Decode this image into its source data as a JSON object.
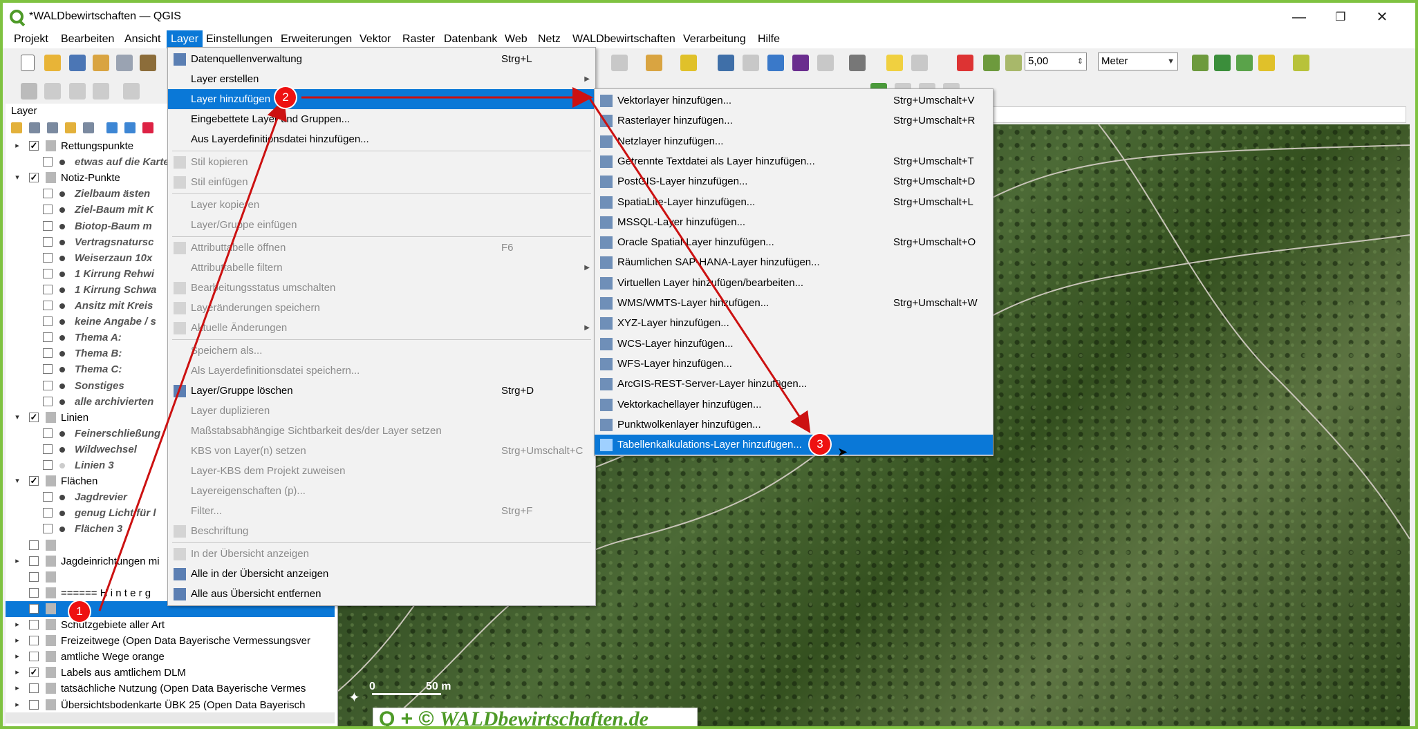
{
  "window": {
    "title": "*WALDbewirtschaften — QGIS",
    "minimize": "—",
    "maximize": "❐",
    "close": "✕"
  },
  "menubar": [
    "Projekt",
    "Bearbeiten",
    "Ansicht",
    "Layer",
    "Einstellungen",
    "Erweiterungen",
    "Vektor",
    "Raster",
    "Datenbank",
    "Web",
    "Netz",
    "WALDbewirtschaften",
    "Verarbeitung",
    "Hilfe"
  ],
  "toolbar": {
    "snap_value": "5,00",
    "unit": "Meter"
  },
  "layer_panel": {
    "title": "Layer",
    "rows": [
      {
        "label": "Rettungspunkte",
        "level": 0,
        "expander": "▸",
        "checked": true,
        "style": "normal"
      },
      {
        "label": "etwas auf die Karte",
        "level": 1,
        "expander": "",
        "checked": false,
        "style": "italic"
      },
      {
        "label": "Notiz-Punkte",
        "level": 0,
        "expander": "▾",
        "checked": true,
        "style": "normal"
      },
      {
        "label": "Zielbaum ästen",
        "level": 1,
        "expander": "",
        "checked": false,
        "style": "italic"
      },
      {
        "label": "Ziel-Baum mit K",
        "level": 1,
        "expander": "",
        "checked": false,
        "style": "italic"
      },
      {
        "label": "Biotop-Baum m",
        "level": 1,
        "expander": "",
        "checked": false,
        "style": "italic"
      },
      {
        "label": "Vertragsnatursc",
        "level": 1,
        "expander": "",
        "checked": false,
        "style": "italic"
      },
      {
        "label": "Weiserzaun 10x",
        "level": 1,
        "expander": "",
        "checked": false,
        "style": "italic"
      },
      {
        "label": "1 Kirrung Rehwi",
        "level": 1,
        "expander": "",
        "checked": false,
        "style": "italic"
      },
      {
        "label": "1 Kirrung Schwa",
        "level": 1,
        "expander": "",
        "checked": false,
        "style": "italic"
      },
      {
        "label": "Ansitz mit Kreis",
        "level": 1,
        "expander": "",
        "checked": false,
        "style": "italic"
      },
      {
        "label": "keine Angabe / s",
        "level": 1,
        "expander": "",
        "checked": false,
        "style": "italic"
      },
      {
        "label": "Thema A:",
        "level": 1,
        "expander": "",
        "checked": false,
        "style": "italic"
      },
      {
        "label": "Thema B:",
        "level": 1,
        "expander": "",
        "checked": false,
        "style": "italic"
      },
      {
        "label": "Thema C:",
        "level": 1,
        "expander": "",
        "checked": false,
        "style": "italic"
      },
      {
        "label": "Sonstiges",
        "level": 1,
        "expander": "",
        "checked": false,
        "style": "italic"
      },
      {
        "label": "alle archivierten",
        "level": 1,
        "expander": "",
        "checked": false,
        "style": "italic"
      },
      {
        "label": "Linien",
        "level": 0,
        "expander": "▾",
        "checked": true,
        "style": "normal"
      },
      {
        "label": "Feinerschließung",
        "level": 1,
        "expander": "",
        "checked": false,
        "style": "italic"
      },
      {
        "label": "Wildwechsel",
        "level": 1,
        "expander": "",
        "checked": false,
        "style": "italic"
      },
      {
        "label": "Linien 3",
        "level": 1,
        "expander": "",
        "checked": false,
        "style": "italic"
      },
      {
        "label": "Flächen",
        "level": 0,
        "expander": "▾",
        "checked": true,
        "style": "normal"
      },
      {
        "label": "Jagdrevier",
        "level": 1,
        "expander": "",
        "checked": false,
        "style": "italic"
      },
      {
        "label": "genug Licht für l",
        "level": 1,
        "expander": "",
        "checked": false,
        "style": "italic"
      },
      {
        "label": "Flächen 3",
        "level": 1,
        "expander": "",
        "checked": false,
        "style": "italic"
      },
      {
        "label": "",
        "level": 0,
        "expander": "",
        "checked": false,
        "style": "normal"
      },
      {
        "label": "Jagdeinrichtungen mi",
        "level": 0,
        "expander": "▸",
        "checked": false,
        "style": "normal"
      },
      {
        "label": "",
        "level": 0,
        "expander": "",
        "checked": false,
        "style": "normal"
      },
      {
        "label": "====== H i n t e r g",
        "level": 0,
        "expander": "",
        "checked": false,
        "style": "normal"
      },
      {
        "label": "",
        "level": 0,
        "expander": "",
        "checked": false,
        "style": "selected"
      },
      {
        "label": "Schutzgebiete aller Art",
        "level": 0,
        "expander": "▸",
        "checked": false,
        "style": "normal"
      },
      {
        "label": "Freizeitwege (Open Data Bayerische Vermessungsver",
        "level": 0,
        "expander": "▸",
        "checked": false,
        "style": "normal"
      },
      {
        "label": "amtliche Wege orange",
        "level": 0,
        "expander": "▸",
        "checked": false,
        "style": "normal"
      },
      {
        "label": "Labels aus amtlichem DLM",
        "level": 0,
        "expander": "▸",
        "checked": true,
        "style": "normal"
      },
      {
        "label": "tatsächliche Nutzung  (Open Data Bayerische Vermes",
        "level": 0,
        "expander": "▸",
        "checked": false,
        "style": "normal"
      },
      {
        "label": "Übersichtsbodenkarte ÜBK 25  (Open Data Bayerisch",
        "level": 0,
        "expander": "▸",
        "checked": false,
        "style": "normal"
      }
    ]
  },
  "layer_menu": {
    "items": [
      {
        "label": "Datenquellenverwaltung",
        "shortcut": "Strg+L",
        "disabled": false,
        "submenu": false,
        "icon": "datasource-icon"
      },
      {
        "label": "Layer erstellen",
        "shortcut": "",
        "disabled": false,
        "submenu": true,
        "icon": ""
      },
      {
        "label": "Layer hinzufügen",
        "shortcut": "",
        "disabled": false,
        "submenu": true,
        "icon": "",
        "highlight": true
      },
      {
        "label": "Eingebettete Layer und Gruppen...",
        "shortcut": "",
        "disabled": false,
        "submenu": false,
        "icon": ""
      },
      {
        "label": "Aus Layerdefinitionsdatei hinzufügen...",
        "shortcut": "",
        "disabled": false,
        "submenu": false,
        "icon": ""
      },
      {
        "sep": true
      },
      {
        "label": "Stil kopieren",
        "shortcut": "",
        "disabled": true,
        "submenu": false,
        "icon": "copy-style-icon"
      },
      {
        "label": "Stil einfügen",
        "shortcut": "",
        "disabled": true,
        "submenu": false,
        "icon": "paste-style-icon"
      },
      {
        "sep": true
      },
      {
        "label": "Layer kopieren",
        "shortcut": "",
        "disabled": true,
        "submenu": false,
        "icon": ""
      },
      {
        "label": "Layer/Gruppe einfügen",
        "shortcut": "",
        "disabled": true,
        "submenu": false,
        "icon": ""
      },
      {
        "sep": true
      },
      {
        "label": "Attributtabelle öffnen",
        "shortcut": "F6",
        "disabled": true,
        "submenu": false,
        "icon": "table-icon"
      },
      {
        "label": "Attributtabelle filtern",
        "shortcut": "",
        "disabled": true,
        "submenu": true,
        "icon": ""
      },
      {
        "label": "Bearbeitungsstatus umschalten",
        "shortcut": "",
        "disabled": true,
        "submenu": false,
        "icon": "pencil-icon"
      },
      {
        "label": "Layeränderungen speichern",
        "shortcut": "",
        "disabled": true,
        "submenu": false,
        "icon": "save-edits-icon"
      },
      {
        "label": "Aktuelle Änderungen",
        "shortcut": "",
        "disabled": true,
        "submenu": true,
        "icon": "pencil-icon"
      },
      {
        "sep": true
      },
      {
        "label": "Speichern als...",
        "shortcut": "",
        "disabled": true,
        "submenu": false,
        "icon": ""
      },
      {
        "label": "Als Layerdefinitionsdatei speichern...",
        "shortcut": "",
        "disabled": true,
        "submenu": false,
        "icon": ""
      },
      {
        "label": "Layer/Gruppe löschen",
        "shortcut": "Strg+D",
        "disabled": false,
        "submenu": false,
        "icon": "remove-layer-icon"
      },
      {
        "label": "Layer duplizieren",
        "shortcut": "",
        "disabled": true,
        "submenu": false,
        "icon": ""
      },
      {
        "label": "Maßstabsabhängige Sichtbarkeit des/der Layer setzen",
        "shortcut": "",
        "disabled": true,
        "submenu": false,
        "icon": ""
      },
      {
        "label": "KBS von Layer(n) setzen",
        "shortcut": "Strg+Umschalt+C",
        "disabled": true,
        "submenu": false,
        "icon": ""
      },
      {
        "label": "Layer-KBS dem Projekt zuweisen",
        "shortcut": "",
        "disabled": true,
        "submenu": false,
        "icon": ""
      },
      {
        "label": "Layereigenschaften (p)...",
        "shortcut": "",
        "disabled": true,
        "submenu": false,
        "icon": ""
      },
      {
        "label": "Filter...",
        "shortcut": "Strg+F",
        "disabled": true,
        "submenu": false,
        "icon": ""
      },
      {
        "label": "Beschriftung",
        "shortcut": "",
        "disabled": true,
        "submenu": false,
        "icon": "label-icon"
      },
      {
        "sep": true
      },
      {
        "label": "In der Übersicht anzeigen",
        "shortcut": "",
        "disabled": true,
        "submenu": false,
        "icon": "overview-icon"
      },
      {
        "label": "Alle in der Übersicht anzeigen",
        "shortcut": "",
        "disabled": false,
        "submenu": false,
        "icon": "overview-all-icon"
      },
      {
        "label": "Alle aus Übersicht entfernen",
        "shortcut": "",
        "disabled": false,
        "submenu": false,
        "icon": "overview-remove-icon"
      }
    ]
  },
  "add_layer_submenu": {
    "items": [
      {
        "label": "Vektorlayer hinzufügen...",
        "shortcut": "Strg+Umschalt+V",
        "icon": "vector-layer-icon"
      },
      {
        "label": "Rasterlayer hinzufügen...",
        "shortcut": "Strg+Umschalt+R",
        "icon": "raster-layer-icon"
      },
      {
        "label": "Netzlayer hinzufügen...",
        "shortcut": "",
        "icon": "mesh-layer-icon"
      },
      {
        "label": "Getrennte Textdatei als Layer hinzufügen...",
        "shortcut": "Strg+Umschalt+T",
        "icon": "delimited-text-icon"
      },
      {
        "label": "PostGIS-Layer hinzufügen...",
        "shortcut": "Strg+Umschalt+D",
        "icon": "postgis-icon"
      },
      {
        "label": "SpatiaLite-Layer hinzufügen...",
        "shortcut": "Strg+Umschalt+L",
        "icon": "spatialite-icon"
      },
      {
        "label": "MSSQL-Layer hinzufügen...",
        "shortcut": "",
        "icon": "mssql-icon"
      },
      {
        "label": "Oracle Spatial-Layer hinzufügen...",
        "shortcut": "Strg+Umschalt+O",
        "icon": "oracle-icon"
      },
      {
        "label": "Räumlichen SAP-HANA-Layer hinzufügen...",
        "shortcut": "",
        "icon": "hana-icon"
      },
      {
        "label": "Virtuellen Layer hinzufügen/bearbeiten...",
        "shortcut": "",
        "icon": "virtual-layer-icon"
      },
      {
        "label": "WMS/WMTS-Layer hinzufügen...",
        "shortcut": "Strg+Umschalt+W",
        "icon": "wms-icon"
      },
      {
        "label": "XYZ-Layer hinzufügen...",
        "shortcut": "",
        "icon": "xyz-icon"
      },
      {
        "label": "WCS-Layer hinzufügen...",
        "shortcut": "",
        "icon": "wcs-icon"
      },
      {
        "label": "WFS-Layer hinzufügen...",
        "shortcut": "",
        "icon": "wfs-icon"
      },
      {
        "label": "ArcGIS-REST-Server-Layer hinzufügen...",
        "shortcut": "",
        "icon": "arcgis-icon"
      },
      {
        "label": "Vektorkachellayer hinzufügen...",
        "shortcut": "",
        "icon": "vector-tile-icon"
      },
      {
        "label": "Punktwolkenlayer hinzufügen...",
        "shortcut": "",
        "icon": "pointcloud-icon"
      },
      {
        "label": "Tabellenkalkulations-Layer hinzufügen...",
        "shortcut": "",
        "icon": "spreadsheet-icon",
        "highlight": true
      }
    ]
  },
  "annotations": {
    "badge1": "1",
    "badge2": "2",
    "badge3": "3",
    "arrow_color": "#cc1111"
  },
  "map": {
    "scale_zero": "0",
    "scale_label": "50 m",
    "watermark": "WALDbewirtschaften.de",
    "watermark_prefix": "Q + ©"
  },
  "colors": {
    "accent": "#0a78d7",
    "frame": "#7fc241",
    "badge": "#e11111"
  }
}
